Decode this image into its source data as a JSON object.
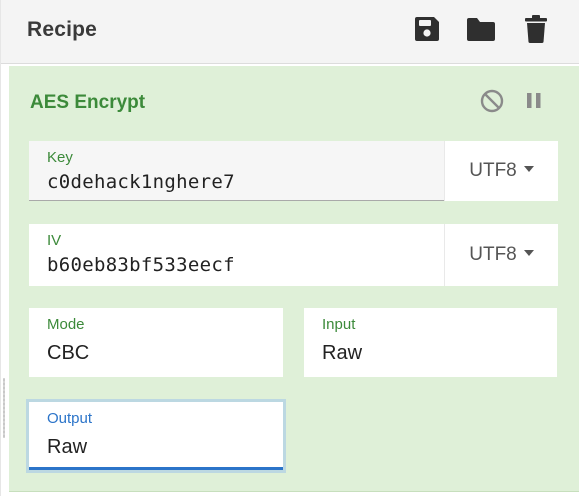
{
  "recipe": {
    "title": "Recipe",
    "actions": [
      {
        "name": "save-recipe",
        "icon": "floppy-disk-icon"
      },
      {
        "name": "load-recipe",
        "icon": "folder-icon"
      },
      {
        "name": "clear-recipe",
        "icon": "trash-icon"
      }
    ]
  },
  "operation": {
    "title": "AES Encrypt",
    "controls": [
      {
        "name": "disable-operation",
        "icon": "disable-icon"
      },
      {
        "name": "breakpoint",
        "icon": "pause-icon"
      }
    ],
    "key": {
      "label": "Key",
      "value": "c0dehack1nghere7",
      "encoding": "UTF8"
    },
    "iv": {
      "label": "IV",
      "value": "b60eb83bf533eecf",
      "encoding": "UTF8"
    },
    "mode": {
      "label": "Mode",
      "value": "CBC"
    },
    "input": {
      "label": "Input",
      "value": "Raw"
    },
    "output": {
      "label": "Output",
      "value": "Raw"
    }
  },
  "colors": {
    "operation_bg": "#dff0d8",
    "operation_title": "#3c8a3a",
    "focus_accent": "#2b74c9"
  }
}
